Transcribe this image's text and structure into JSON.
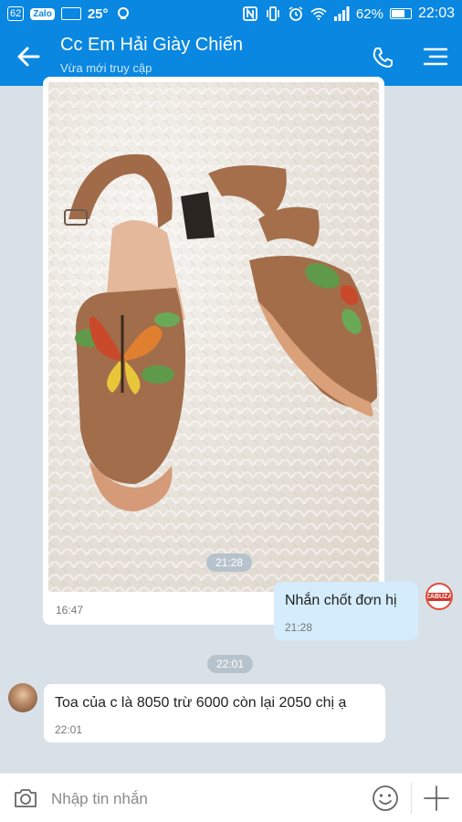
{
  "status_bar": {
    "left_badge": "62",
    "app_badge": "Zalo",
    "temperature": "25°",
    "battery": "62%",
    "time": "22:03"
  },
  "header": {
    "title": "Cc Em Hải Giày Chiến",
    "subtitle": "Vừa mới truy cập",
    "icons": [
      "back-arrow-icon",
      "phone-icon",
      "menu-icon"
    ]
  },
  "messages": [
    {
      "type": "image",
      "direction": "incoming",
      "time": "16:47",
      "content": "photo of tan suede block-heel sandals with butterfly embroidery"
    },
    {
      "type": "time_divider",
      "text": "21:28"
    },
    {
      "type": "text",
      "direction": "outgoing",
      "text": "Nhắn chốt đơn hị",
      "time": "21:28",
      "avatar_label": "ZABUZA"
    },
    {
      "type": "time_divider",
      "text": "22:01"
    },
    {
      "type": "text",
      "direction": "incoming",
      "text": "Toa của c là 8050 trừ 6000 còn lại 2050 chị ạ",
      "time": "22:01"
    }
  ],
  "composer": {
    "placeholder": "Nhập tin nhắn",
    "icons": [
      "camera-icon",
      "emoji-icon",
      "plus-icon"
    ]
  },
  "colors": {
    "header": "#0a87e0",
    "chat_background": "#d9e1e8",
    "outgoing_bubble": "#d4ecfb",
    "incoming_bubble": "#ffffff",
    "time_pill": "#b7c3cc"
  }
}
